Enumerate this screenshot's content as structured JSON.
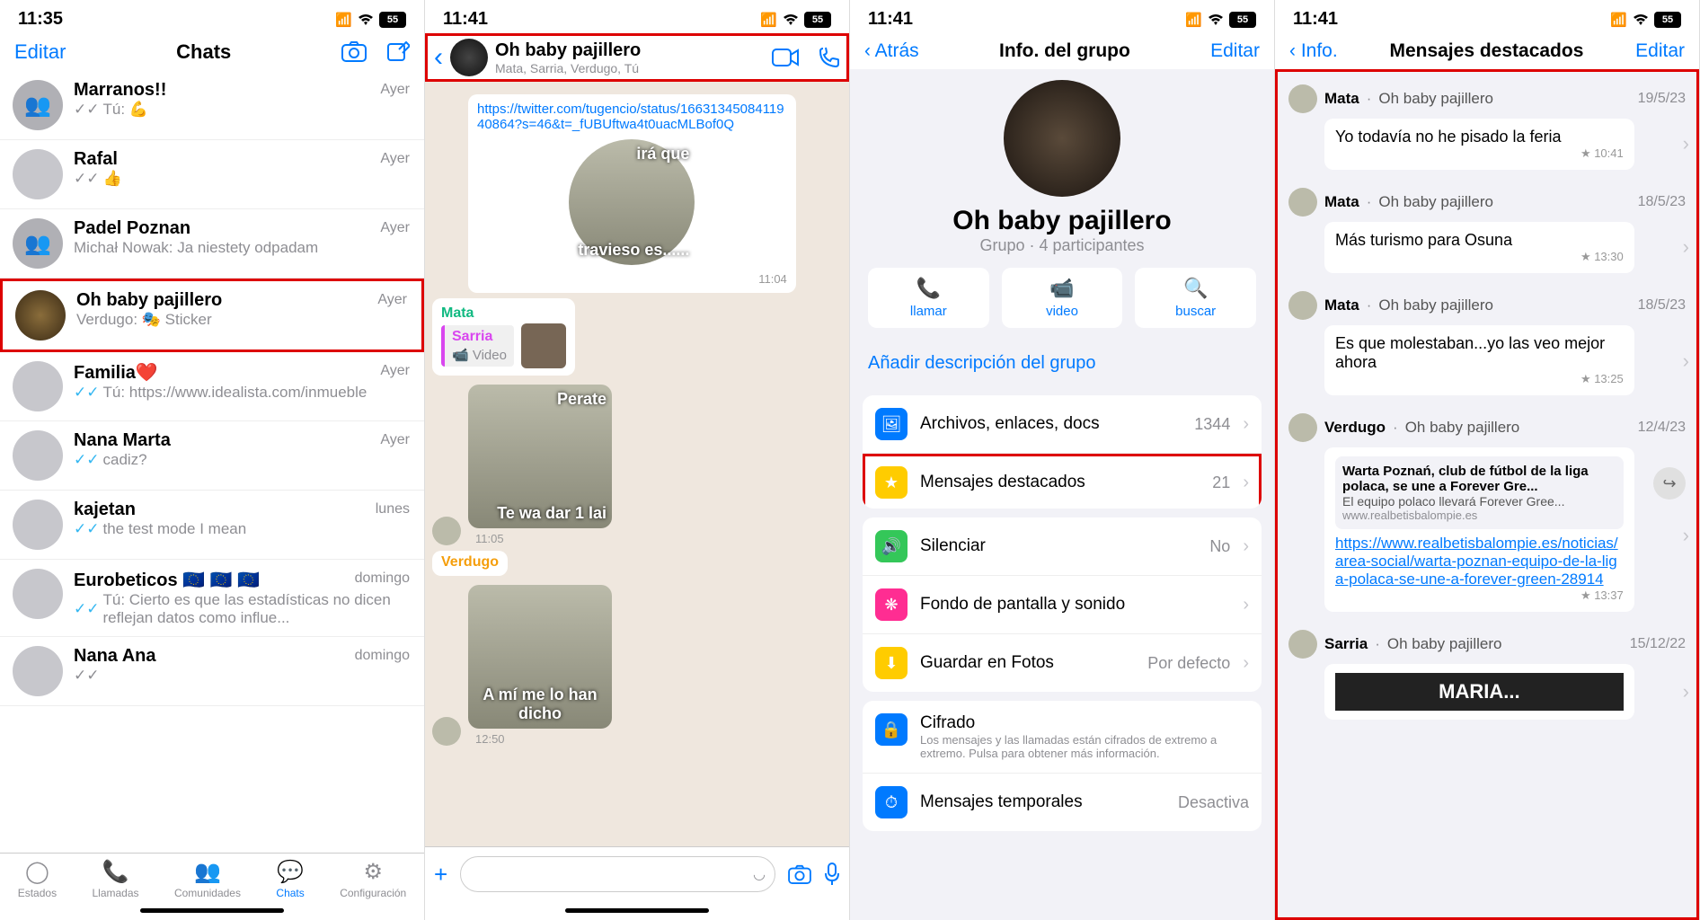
{
  "status": {
    "time1": "11:35",
    "time2": "11:41",
    "battery": "55"
  },
  "s1": {
    "edit": "Editar",
    "title": "Chats",
    "chats": [
      {
        "name": "Marranos!!",
        "preview": "Tú: 💪",
        "time": "Ayer",
        "read": false
      },
      {
        "name": "Rafal",
        "preview": "👍",
        "time": "Ayer",
        "read": false
      },
      {
        "name": "Padel Poznan",
        "preview": "Michał Nowak: Ja niestety odpadam",
        "time": "Ayer",
        "nocheck": true
      },
      {
        "name": "Oh baby pajillero",
        "preview": "Verdugo: 🎭 Sticker",
        "time": "Ayer",
        "nocheck": true,
        "highlight": true
      },
      {
        "name": "Familia❤️",
        "preview": "Tú: https://www.idealista.com/inmueble",
        "time": "Ayer",
        "read": true
      },
      {
        "name": "Nana Marta",
        "preview": "cadiz?",
        "time": "Ayer",
        "read": true
      },
      {
        "name": "kajetan",
        "preview": "the test mode I mean",
        "time": "lunes",
        "read": true
      },
      {
        "name": "Eurobeticos 🇪🇺 🇪🇺 🇪🇺",
        "preview": "Tú: Cierto es que las estadísticas no dicen reflejan datos como influe...",
        "time": "domingo",
        "read": true
      },
      {
        "name": "Nana Ana",
        "preview": "",
        "time": "domingo"
      }
    ],
    "tabs": [
      "Estados",
      "Llamadas",
      "Comunidades",
      "Chats",
      "Configuración"
    ]
  },
  "s2": {
    "title": "Oh baby pajillero",
    "members": "Mata, Sarria, Verdugo, Tú",
    "msg_link": "https://twitter.com/tugencio/status/1663134508411940864?s=46&t=_fUBUftwa4t0uacMLBof0Q",
    "sticker1_top": "irá que",
    "sticker1_bottom": "travieso es......",
    "t1": "11:04",
    "sender_mata": "Mata",
    "sender_sarria": "Sarria",
    "video_label": "📹 Video",
    "sticker2_top": "Perate",
    "sticker2_bottom": "Te wa dar 1 lai",
    "t2": "11:05",
    "sender_verdugo": "Verdugo",
    "sticker3": "A mí me lo han dicho",
    "t3": "12:50"
  },
  "s3": {
    "back": "Atrás",
    "title": "Info. del grupo",
    "edit": "Editar",
    "group_name": "Oh baby pajillero",
    "group_sub": "Grupo · 4 participantes",
    "actions": {
      "call": "llamar",
      "video": "video",
      "search": "buscar"
    },
    "add_desc": "Añadir descripción del grupo",
    "rows": {
      "media": {
        "label": "Archivos, enlaces, docs",
        "value": "1344"
      },
      "starred": {
        "label": "Mensajes destacados",
        "value": "21"
      },
      "mute": {
        "label": "Silenciar",
        "value": "No"
      },
      "wallpaper": {
        "label": "Fondo de pantalla y sonido"
      },
      "save": {
        "label": "Guardar en Fotos",
        "value": "Por defecto"
      },
      "encrypt": {
        "label": "Cifrado",
        "sub": "Los mensajes y las llamadas están cifrados de extremo a extremo. Pulsa para obtener más información."
      },
      "temporal": {
        "label": "Mensajes temporales",
        "value": "Desactiva"
      }
    }
  },
  "s4": {
    "back": "Info.",
    "title": "Mensajes destacados",
    "edit": "Editar",
    "items": [
      {
        "sender": "Mata",
        "group": "Oh baby pajillero",
        "date": "19/5/23",
        "text": "Yo todavía no he pisado la feria",
        "time": "10:41"
      },
      {
        "sender": "Mata",
        "group": "Oh baby pajillero",
        "date": "18/5/23",
        "text": "Más turismo para Osuna",
        "time": "13:30"
      },
      {
        "sender": "Mata",
        "group": "Oh baby pajillero",
        "date": "18/5/23",
        "text": "Es que molestaban...yo las veo mejor ahora",
        "time": "13:25"
      },
      {
        "sender": "Verdugo",
        "group": "Oh baby pajillero",
        "date": "12/4/23",
        "lp_title": "Warta Poznań, club de fútbol de la liga polaca, se une a Forever Gre...",
        "lp_desc": "El equipo polaco llevará Forever Gree...",
        "lp_domain": "www.realbetisbalompie.es",
        "url": "https://www.realbetisbalompie.es/noticias/area-social/warta-poznan-equipo-de-la-liga-polaca-se-une-a-forever-green-28914",
        "time": "13:37"
      },
      {
        "sender": "Sarria",
        "group": "Oh baby pajillero",
        "date": "15/12/22",
        "sticker": "MARIA..."
      }
    ]
  }
}
